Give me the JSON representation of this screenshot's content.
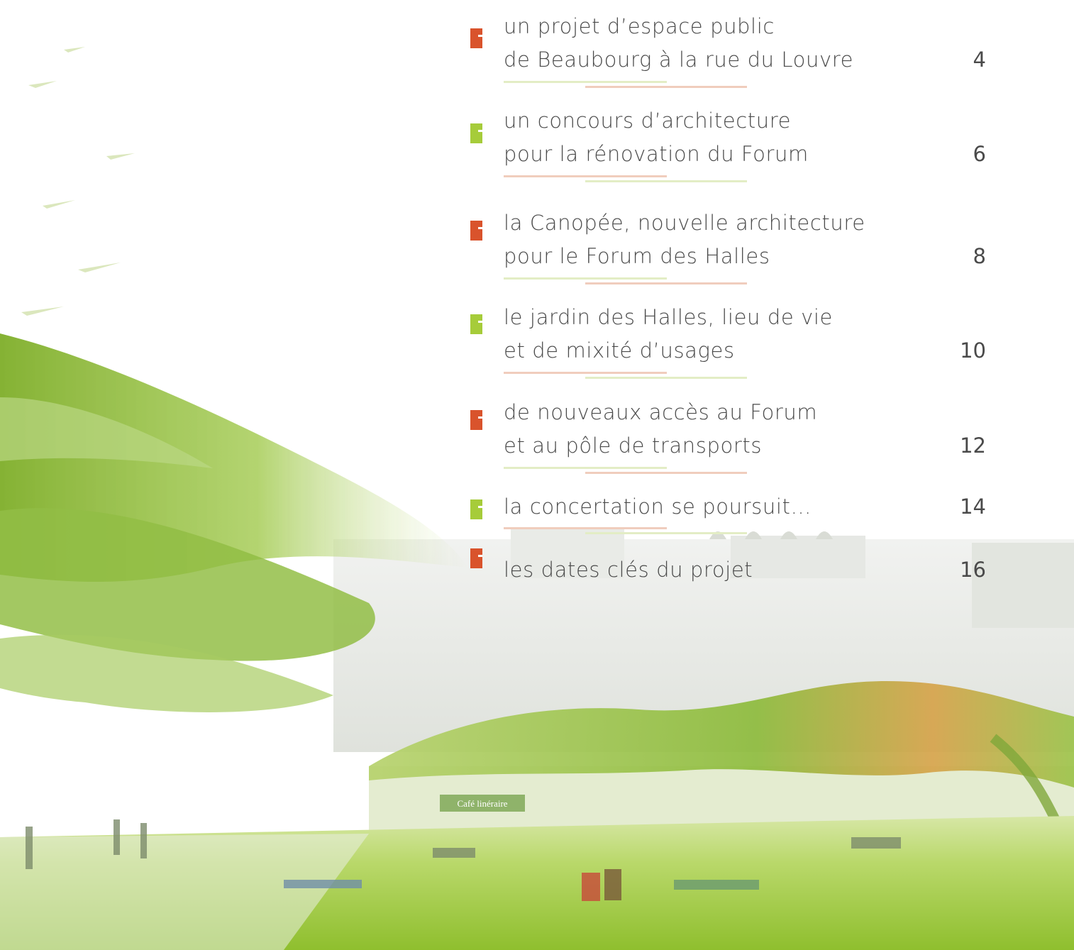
{
  "toc": {
    "entries": [
      {
        "line1": "un projet d’espace public",
        "line2": "de Beaubourg à la rue du Louvre",
        "page": "4",
        "marker": "red"
      },
      {
        "line1": "un concours d’architecture",
        "line2": "pour la rénovation du Forum",
        "page": "6",
        "marker": "green"
      },
      {
        "line1": "la Canopée, nouvelle architecture",
        "line2": "pour le Forum des Halles",
        "page": "8",
        "marker": "red"
      },
      {
        "line1": "le jardin des Halles, lieu de vie",
        "line2": "et de mixité d’usages",
        "page": "10",
        "marker": "green"
      },
      {
        "line1": "de nouveaux accès au Forum",
        "line2": "et au pôle de transports",
        "page": "12",
        "marker": "red"
      },
      {
        "line1": "la concertation se poursuit…",
        "page": "14",
        "marker": "green"
      },
      {
        "line1": "les dates clés du projet",
        "page": "16",
        "marker": "red"
      }
    ]
  },
  "illustration": {
    "sign_text": "Café linéraire"
  },
  "colors": {
    "marker_red": "#d9532c",
    "marker_green": "#a6cc3a",
    "rule_pink": "#f0cdbd",
    "rule_lime": "#e3edc5",
    "text": "#4a4a4a"
  }
}
